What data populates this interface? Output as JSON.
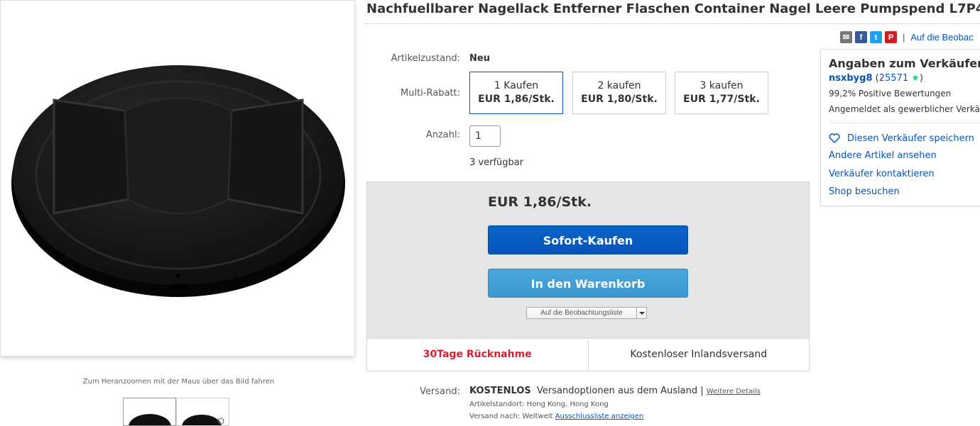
{
  "product": {
    "title": "Nachfuellbarer Nagellack Entferner Flaschen Container Nagel Leere Pumpspend L7P4",
    "zoom_hint": "Zum Heranzoomen mit der Maus über das Bild fahren"
  },
  "share": {
    "icons": [
      "mail-icon",
      "facebook-icon",
      "twitter-icon",
      "pinterest-icon"
    ],
    "facebook_glyph": "f",
    "twitter_glyph": "t",
    "pinterest_glyph": "P",
    "separator": "|",
    "watch_label": "Auf die Beobac"
  },
  "condition": {
    "label": "Artikelzustand:",
    "value": "Neu"
  },
  "multi_discount": {
    "label": "Multi-Rabatt:",
    "tiers": [
      {
        "qty": "1 Kaufen",
        "price": "EUR 1,86/Stk.",
        "selected": true
      },
      {
        "qty": "2 kaufen",
        "price": "EUR 1,80/Stk.",
        "selected": false
      },
      {
        "qty": "3 kaufen",
        "price": "EUR 1,77/Stk.",
        "selected": false
      }
    ]
  },
  "quantity": {
    "label": "Anzahl:",
    "value": "1",
    "available": "3 verfügbar"
  },
  "buybox": {
    "price": "EUR 1,86/Stk.",
    "buy_now": "Sofort-Kaufen",
    "add_to_cart": "In den Warenkorb",
    "watchlist": "Auf die Beobachtungsliste",
    "returns": "30Tage Rücknahme",
    "free_shipping": "Kostenloser Inlandsversand"
  },
  "shipping": {
    "label": "Versand:",
    "cost": "KOSTENLOS",
    "options": "Versandoptionen aus dem Ausland",
    "separator": "|",
    "details_link": "Weitere Details",
    "location_label": "Artikelstandort:",
    "location": "Hong Kong, Hong Kong",
    "ships_to_label": "Versand nach:",
    "ships_to": "Weltweit",
    "exclusions_link": "Ausschlussliste anzeigen"
  },
  "seller": {
    "heading": "Angaben zum Verkäufer",
    "name": "nsxbyg8",
    "score_open": "(",
    "score": "25571",
    "score_close": ")",
    "feedback": "99,2% Positive Bewertungen",
    "registered": "Angemeldet als gewerblicher Verkäufer",
    "save_seller": "Diesen Verkäufer speichern",
    "other_items": "Andere Artikel ansehen",
    "contact": "Verkäufer kontaktieren",
    "shop": "Shop besuchen"
  },
  "colors": {
    "link": "#0654ba",
    "buy_button": "#0654ba",
    "cart_button": "#3a97cf",
    "returns_red": "#dd1e31"
  }
}
